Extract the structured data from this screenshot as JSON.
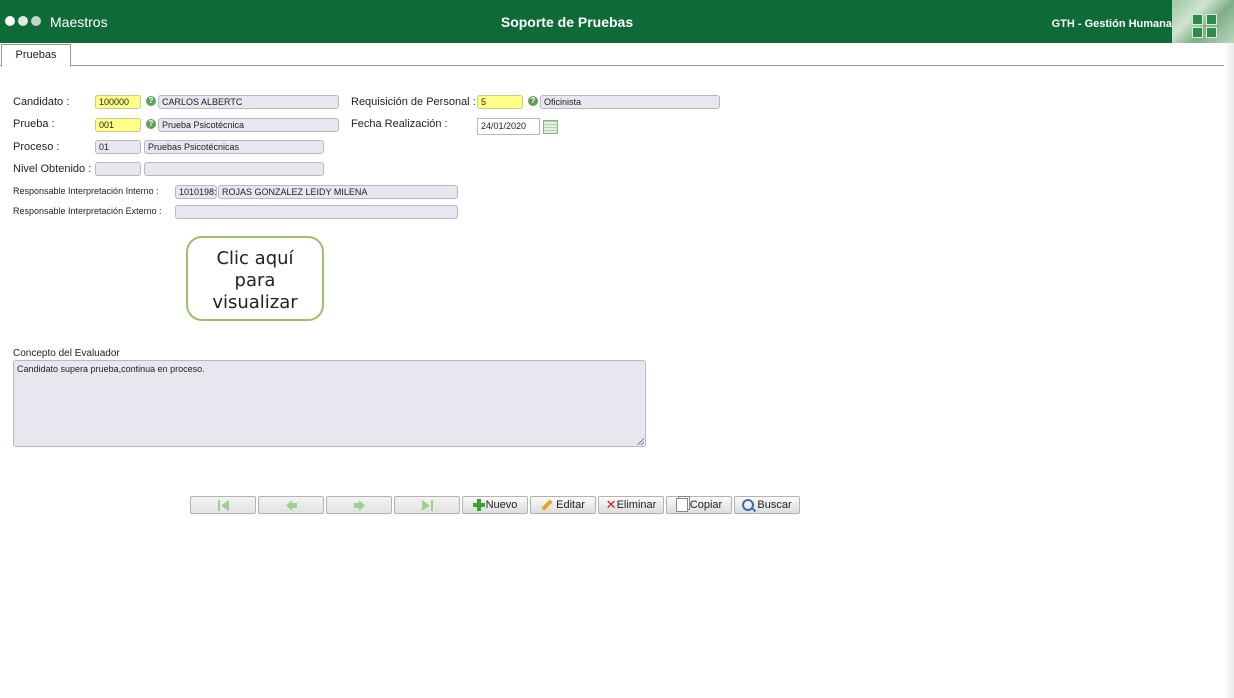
{
  "header": {
    "brand": "Maestros",
    "title": "Soporte de Pruebas",
    "app_name": "GTH - Gestión Humana"
  },
  "tabs": [
    {
      "label": "Pruebas"
    }
  ],
  "form": {
    "candidato": {
      "label": "Candidato :",
      "code": "100000",
      "name": "CARLOS ALBERTC"
    },
    "requisicion": {
      "label": "Requisición de Personal :",
      "code": "5",
      "name": "Oficinista"
    },
    "prueba": {
      "label": "Prueba :",
      "code": "001",
      "name": "Prueba Psicotécnica"
    },
    "fecha": {
      "label": "Fecha Realización :",
      "value": "24/01/2020"
    },
    "proceso": {
      "label": "Proceso :",
      "code": "01",
      "name": "Pruebas Psicotécnicas"
    },
    "nivel": {
      "label": "Nivel Obtenido :",
      "code": "",
      "name": ""
    },
    "resp_interno": {
      "label": "Responsable Interpretación Interno :",
      "code": "1010198:",
      "name": "ROJAS GONZALEZ LEIDY MILENA"
    },
    "resp_externo": {
      "label": "Responsable Interpretación Externo :",
      "value": ""
    },
    "view_button": {
      "line1": "Clic aquí",
      "line2": "para",
      "line3": "visualizar"
    },
    "concepto": {
      "label": "Concepto del Evaluador",
      "value": "Candidato supera prueba,continua en proceso."
    }
  },
  "toolbar": {
    "nuevo": "Nuevo",
    "editar": "Editar",
    "eliminar": "Eliminar",
    "copiar": "Copiar",
    "buscar": "Buscar"
  }
}
